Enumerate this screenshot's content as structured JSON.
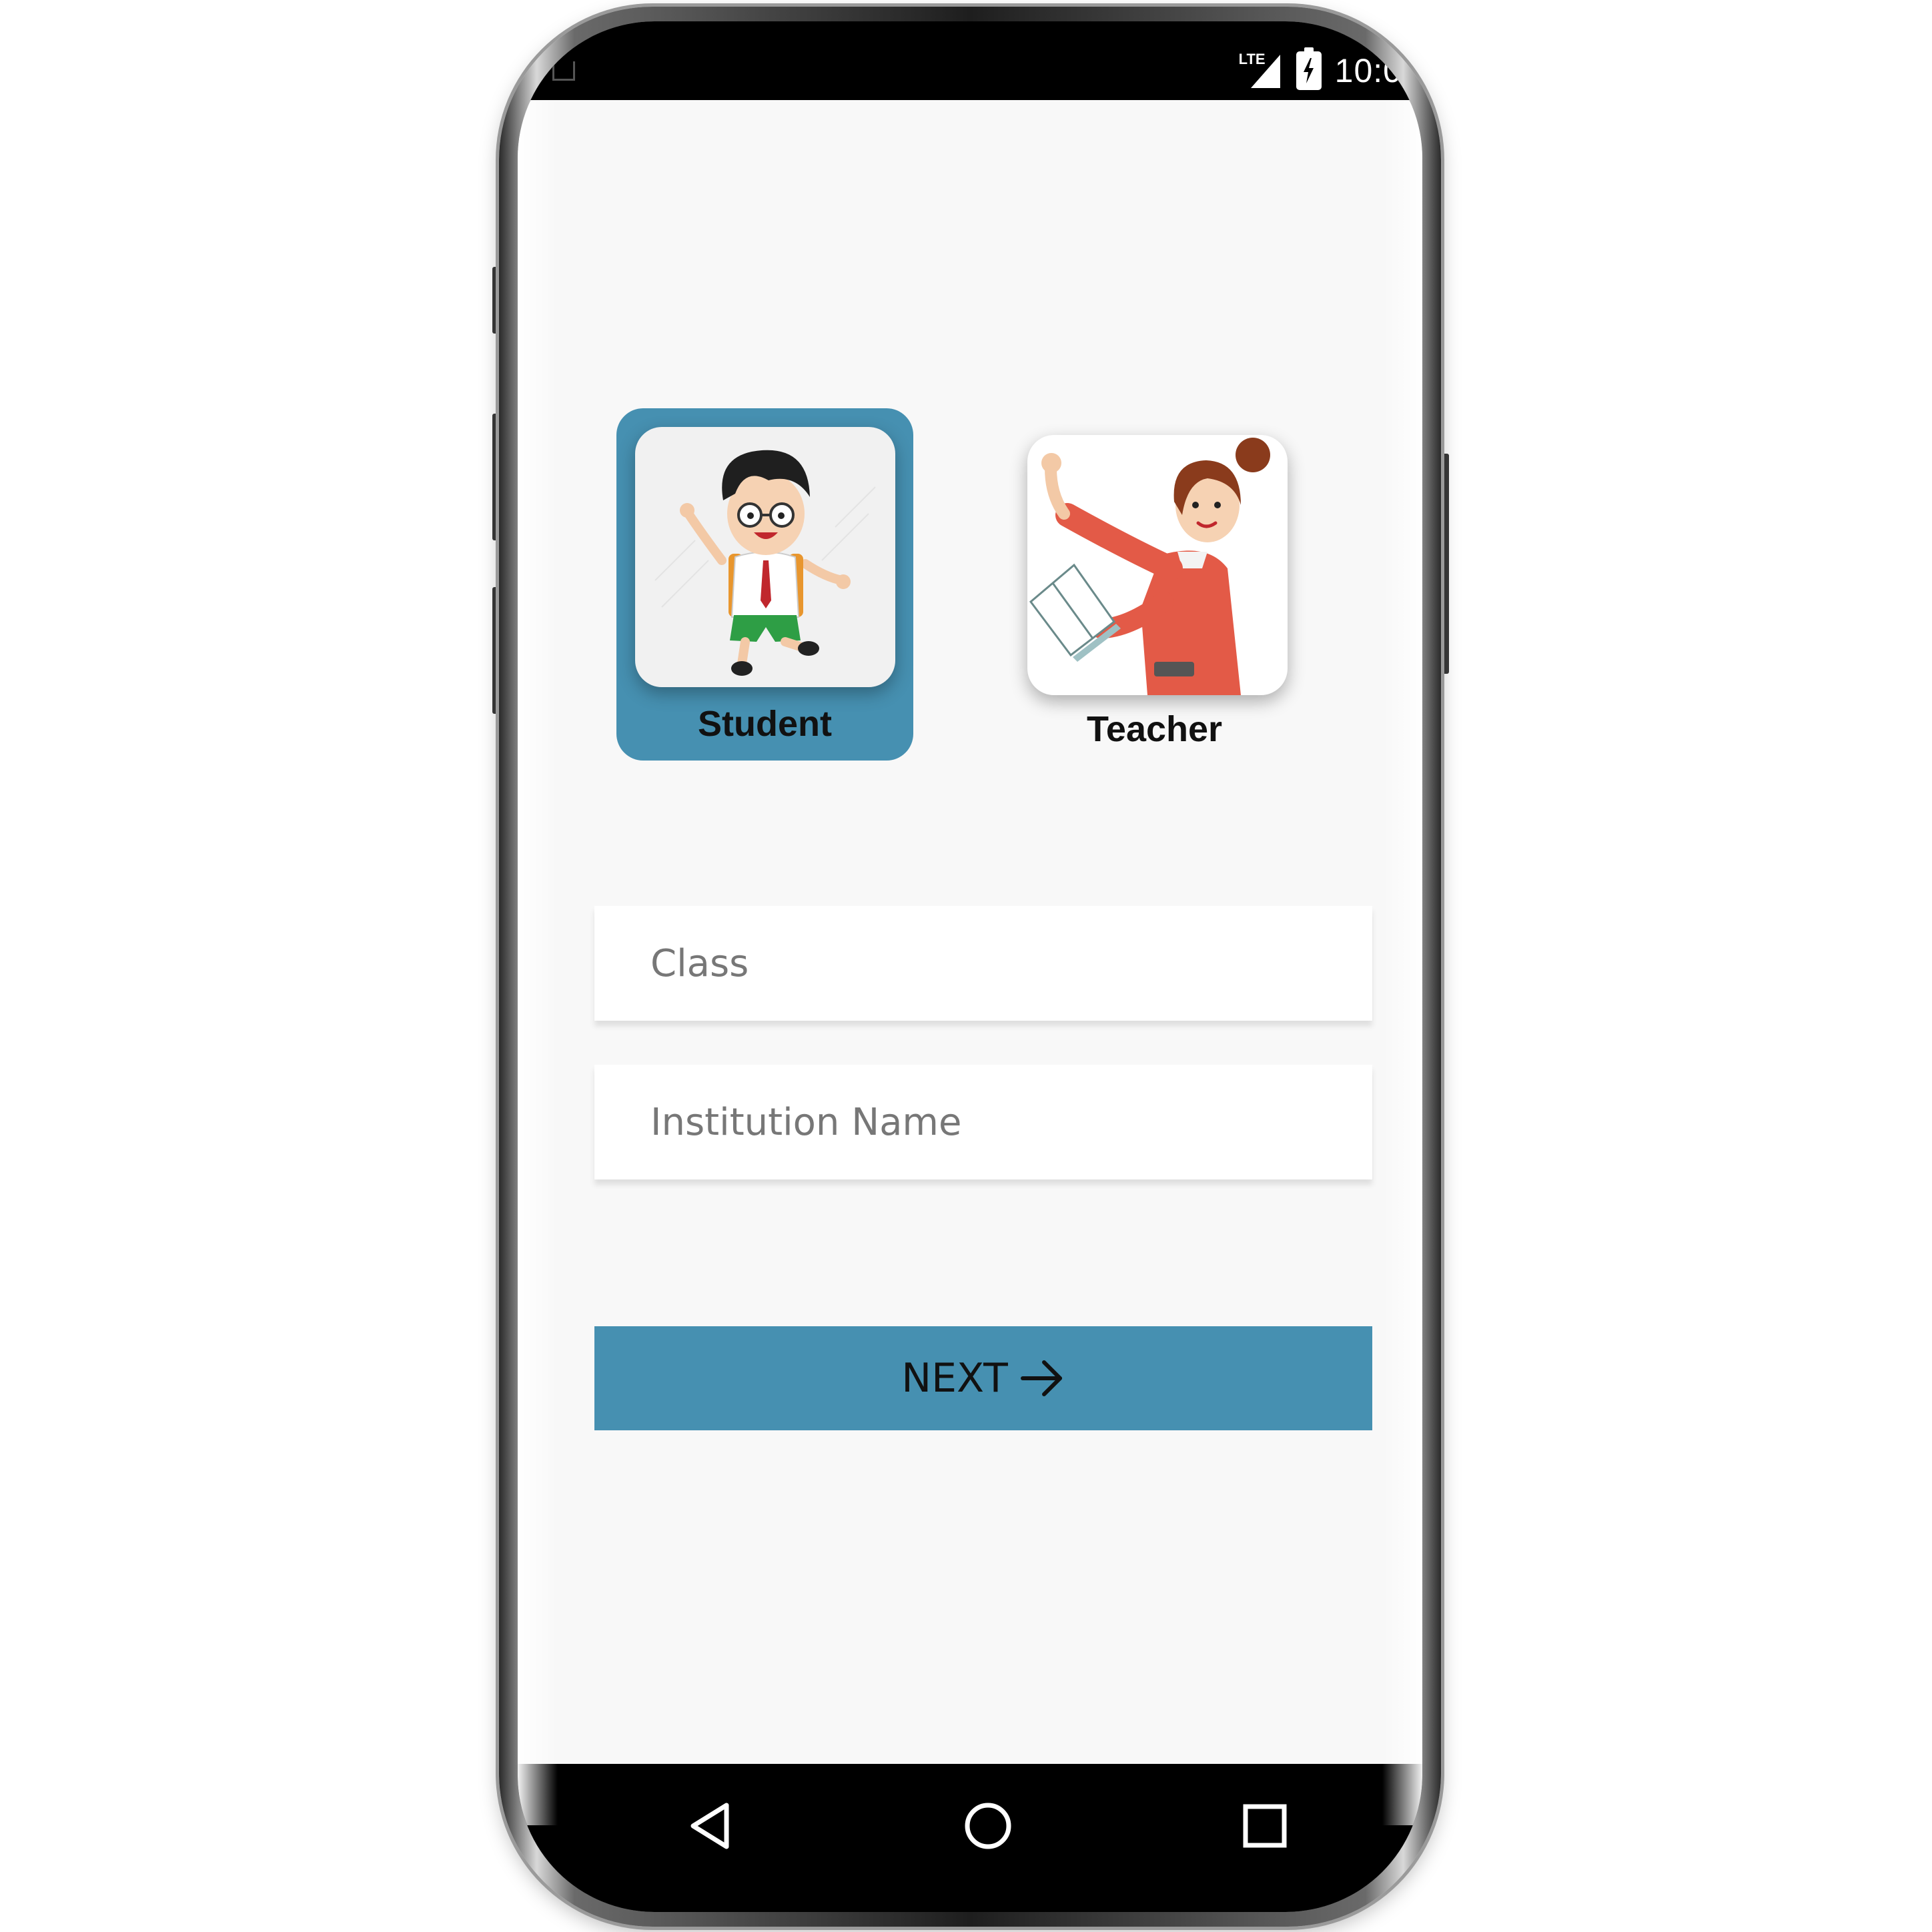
{
  "status_bar": {
    "network": "LTE",
    "time": "10:0",
    "icons": [
      "notification-icon",
      "lte-signal-icon",
      "battery-charging-icon"
    ]
  },
  "roles": [
    {
      "label": "Student",
      "selected": true,
      "icon": "student-illustration"
    },
    {
      "label": "Teacher",
      "selected": false,
      "icon": "teacher-illustration"
    }
  ],
  "form": {
    "class_placeholder": "Class",
    "class_value": "",
    "institution_placeholder": "Institution Name",
    "institution_value": ""
  },
  "next_button": {
    "label": "NEXT",
    "icon": "arrow-right-icon"
  },
  "nav_bar": {
    "icons": [
      "back-icon",
      "home-icon",
      "recents-icon"
    ]
  },
  "colors": {
    "accent": "#4690b1",
    "screen_background": "#f8f8f8",
    "field_background": "#ffffff",
    "bars": "#000000"
  }
}
